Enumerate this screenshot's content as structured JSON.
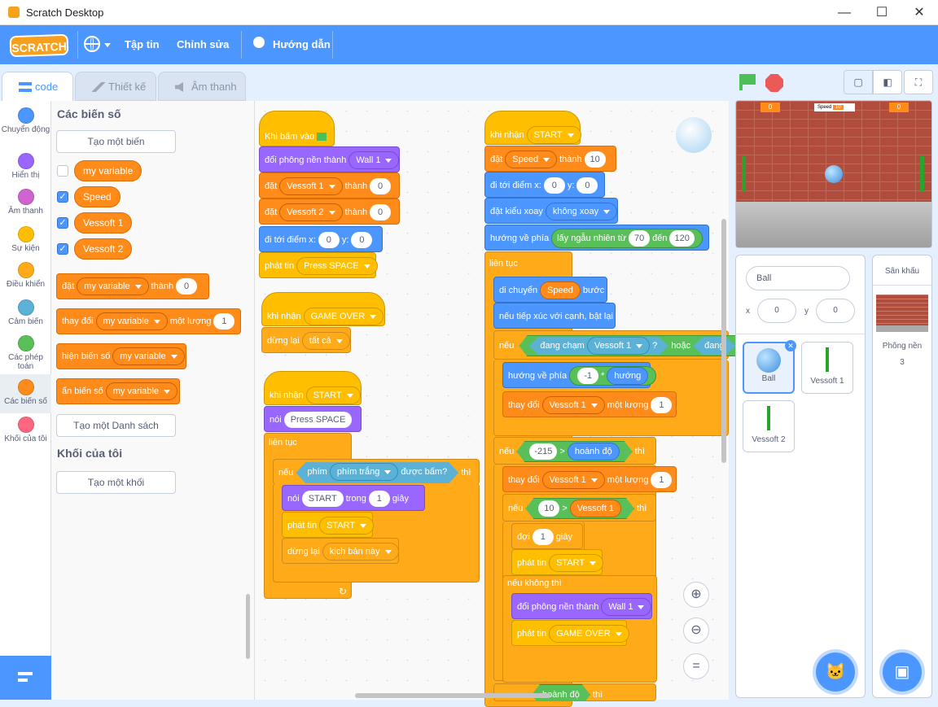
{
  "window": {
    "title": "Scratch Desktop",
    "min": "—",
    "max": "☐",
    "close": "✕"
  },
  "menu": {
    "logo": "SCRATCH",
    "file": "Tập tin",
    "edit": "Chỉnh sửa",
    "tutorials": "Hướng dẫn"
  },
  "tabs": {
    "code": "code",
    "costumes": "Thiết kế",
    "sounds": "Âm thanh"
  },
  "categories": [
    {
      "label": "Chuyển động",
      "color": "#4c97ff"
    },
    {
      "label": "Hiển thị",
      "color": "#9966ff"
    },
    {
      "label": "Âm thanh",
      "color": "#cf63cf"
    },
    {
      "label": "Sự kiện",
      "color": "#ffbf00"
    },
    {
      "label": "Điều khiển",
      "color": "#ffab19"
    },
    {
      "label": "Cảm biến",
      "color": "#5cb1d6"
    },
    {
      "label": "Các phép toán",
      "color": "#59c059"
    },
    {
      "label": "Các biến số",
      "color": "#ff8c1a"
    },
    {
      "label": "Khối của tôi",
      "color": "#ff6680"
    }
  ],
  "palette": {
    "variables_heading": "Các biến số",
    "make_variable": "Tạo một biến",
    "variables": [
      {
        "name": "my variable",
        "checked": false
      },
      {
        "name": "Speed",
        "checked": true
      },
      {
        "name": "Vessoft 1",
        "checked": true
      },
      {
        "name": "Vessoft 2",
        "checked": true
      }
    ],
    "set_block": {
      "a": "đặt",
      "var": "my variable",
      "b": "thành",
      "val": "0"
    },
    "change_block": {
      "a": "thay đổi",
      "var": "my variable",
      "b": "một lượng",
      "val": "1"
    },
    "show_block": {
      "a": "hiện biến số",
      "var": "my variable"
    },
    "hide_block": {
      "a": "ẩn biến số",
      "var": "my variable"
    },
    "make_list": "Tạo một Danh sách",
    "myblocks_heading": "Khối của tôi",
    "make_block": "Tạo một khối"
  },
  "scripts": {
    "s1": {
      "hat": "Khi bấm vào",
      "b1a": "đổi phông nền thành",
      "b1v": "Wall 1",
      "b2a": "đặt",
      "b2v": "Vessoft 1",
      "b2b": "thành",
      "b2n": "0",
      "b3a": "đặt",
      "b3v": "Vessoft 2",
      "b3b": "thành",
      "b3n": "0",
      "b4a": "đi tới điểm x:",
      "b4x": "0",
      "b4b": "y:",
      "b4y": "0",
      "b5a": "phát tin",
      "b5v": "Press SPACE"
    },
    "s2": {
      "hat": "khi nhận",
      "hatv": "GAME OVER",
      "b1": "dừng lại",
      "b1v": "tất cả"
    },
    "s3": {
      "hat": "khi nhận",
      "hatv": "START",
      "say": "nói",
      "sayv": "Press SPACE",
      "forever": "liên tục",
      "if": "nếu",
      "key": "phím",
      "keyv": "phím trắng",
      "pressed": "được bấm?",
      "then": "thì",
      "say2": "nói",
      "say2v": "START",
      "say2b": "trong",
      "say2n": "1",
      "say2c": "giây",
      "bc": "phát tin",
      "bcv": "START",
      "stop": "dừng lại",
      "stopv": "kịch bản này"
    },
    "s4": {
      "hat": "khi nhận",
      "hatv": "START",
      "set": "đặt",
      "setv": "Speed",
      "setb": "thành",
      "setn": "10",
      "goto": "đi tới điểm x:",
      "gx": "0",
      "gy": "y:",
      "gyv": "0",
      "rot": "đặt kiểu xoay",
      "rotv": "không xoay",
      "dir": "hướng về phía",
      "rand": "lấy ngẫu nhiên từ",
      "r1": "70",
      "to": "đến",
      "r2": "120",
      "forever": "liên tục",
      "move": "di chuyển",
      "movev": "Speed",
      "steps": "bước",
      "bounce": "nếu tiếp xúc với cạnh, bật lại",
      "if1": "nếu",
      "touch": "đang chạm",
      "touchv": "Vessoft 1",
      "q": "?",
      "or": "hoặc",
      "touch2": "đang",
      "point": "hướng về phía",
      "neg": "-1",
      "mul": "*",
      "dirv": "hướng",
      "ch1": "thay đổi",
      "ch1v": "Vessoft 1",
      "ch1b": "một lượng",
      "ch1n": "1",
      "if2": "nếu",
      "lt": "-215",
      "gt": ">",
      "xpos": "hoành độ",
      "then": "thì",
      "ch2": "thay đổi",
      "ch2v": "Vessoft 1",
      "ch2b": "một lượng",
      "ch2n": "1",
      "if3": "nếu",
      "ten": "10",
      "gt2": ">",
      "v1": "Vessoft 1",
      "then3": "thì",
      "wait": "đợi",
      "waitn": "1",
      "secs": "giây",
      "bc": "phát tin",
      "bcv": "START",
      "else": "nếu không thì",
      "bd": "đổi phông nền thành",
      "bdv": "Wall 1",
      "bc2": "phát tin",
      "bc2v": "GAME OVER",
      "bottom": "hoành độ",
      "bthen": "thì"
    }
  },
  "stage": {
    "score_left": "0",
    "score_right": "0",
    "speed_label": "Speed",
    "speed_val": "10"
  },
  "sprite_info": {
    "name": "Ball",
    "x_label": "x",
    "x": "0",
    "y_label": "y",
    "y": "0"
  },
  "sprites": [
    {
      "name": "Ball"
    },
    {
      "name": "Vessoft 1"
    },
    {
      "name": "Vessoft 2"
    }
  ],
  "stage_panel": {
    "title": "Sân khấu",
    "backdrops_label": "Phông nền",
    "backdrops_count": "3"
  }
}
